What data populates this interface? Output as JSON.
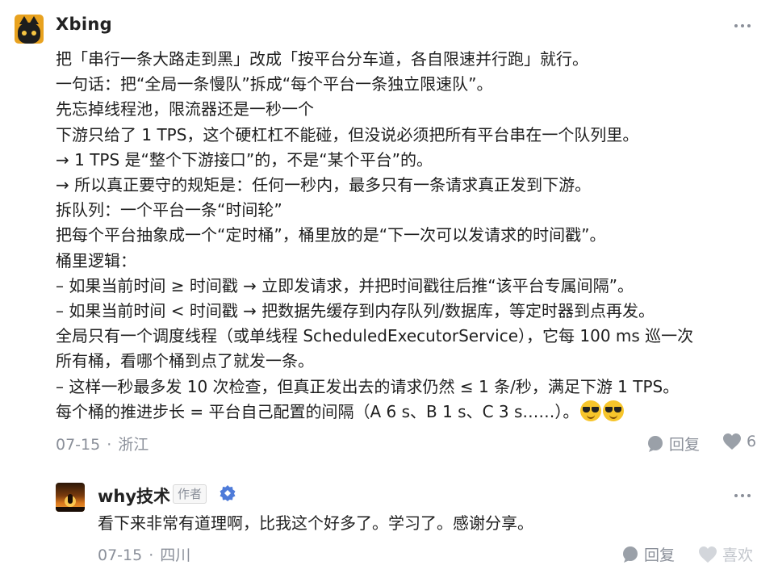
{
  "comment": {
    "author": "Xbing",
    "lines": [
      "把「串行一条大路走到黑」改成「按平台分车道，各自限速并行跑」就行。",
      "一句话：把“全局一条慢队”拆成“每个平台一条独立限速队”。",
      "先忘掉线程池，限流器还是一秒一个",
      "下游只给了 1 TPS，这个硬杠杠不能碰，但没说必须把所有平台串在一个队列里。",
      "→ 1 TPS 是“整个下游接口”的，不是“某个平台”的。",
      "→ 所以真正要守的规矩是：任何一秒内，最多只有一条请求真正发到下游。",
      "拆队列：一个平台一条“时间轮”",
      "把每个平台抽象成一个“定时桶”，桶里放的是“下一次可以发请求的时间戳”。",
      "桶里逻辑：",
      "– 如果当前时间 ≥ 时间戳 → 立即发请求，并把时间戳往后推“该平台专属间隔”。",
      "– 如果当前时间 < 时间戳 → 把数据先缓存到内存队列/数据库，等定时器到点再发。",
      "全局只有一个调度线程（或单线程 ScheduledExecutorService），它每 100 ms 巡一次",
      "所有桶，看哪个桶到点了就发一条。",
      "– 这样一秒最多发 10 次检查，但真正发出去的请求仍然 ≤ 1 条/秒，满足下游 1 TPS。",
      "每个桶的推进步长 = 平台自己配置的间隔（A 6 s、B 1 s、C 3 s……）。"
    ],
    "emojis": [
      "sunglasses-emoji",
      "sunglasses-emoji"
    ],
    "date": "07-15",
    "separator": "·",
    "location": "浙江",
    "reply_label": "回复",
    "like_count": "6"
  },
  "reply": {
    "author": "why技术",
    "badge": "作者",
    "text": "看下来非常有道理啊，比我这个好多了。学习了。感谢分享。",
    "date": "07-15",
    "separator": "·",
    "location": "四川",
    "reply_label": "回复",
    "like_label": "喜欢"
  },
  "colors": {
    "text": "#1f1f1f",
    "meta": "#8a8f99",
    "verified": "#4e7bd9"
  }
}
